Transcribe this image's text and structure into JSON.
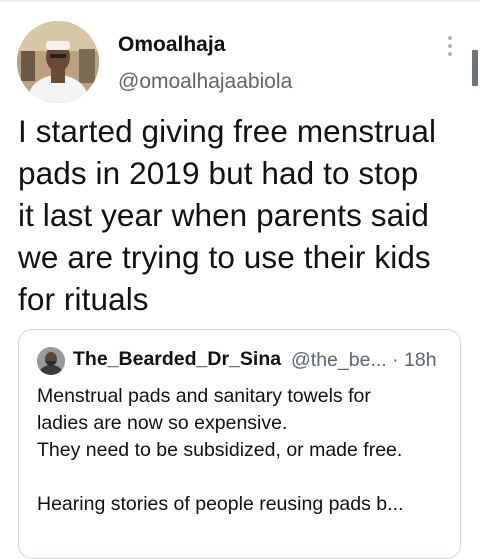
{
  "tweet": {
    "display_name": "Omoalhaja",
    "handle": "@omoalhajaabiola",
    "text_lines": [
      "I started giving free menstrual",
      "pads in 2019 but had to stop",
      "it last year when parents said",
      "we are trying to use their kids",
      "for rituals"
    ]
  },
  "quoted": {
    "display_name": "The_Bearded_Dr_Sina",
    "meta": "@the_be... · 18h",
    "lines": [
      "Menstrual pads and sanitary towels for",
      "ladies are now so expensive.",
      "They need to be subsidized, or made free.",
      "",
      "Hearing stories of people reusing pads b..."
    ]
  },
  "icons": {
    "more": "more-vertical-icon"
  },
  "colors": {
    "text": "#111111",
    "secondary": "#5b6670",
    "border": "#cfd9de"
  }
}
